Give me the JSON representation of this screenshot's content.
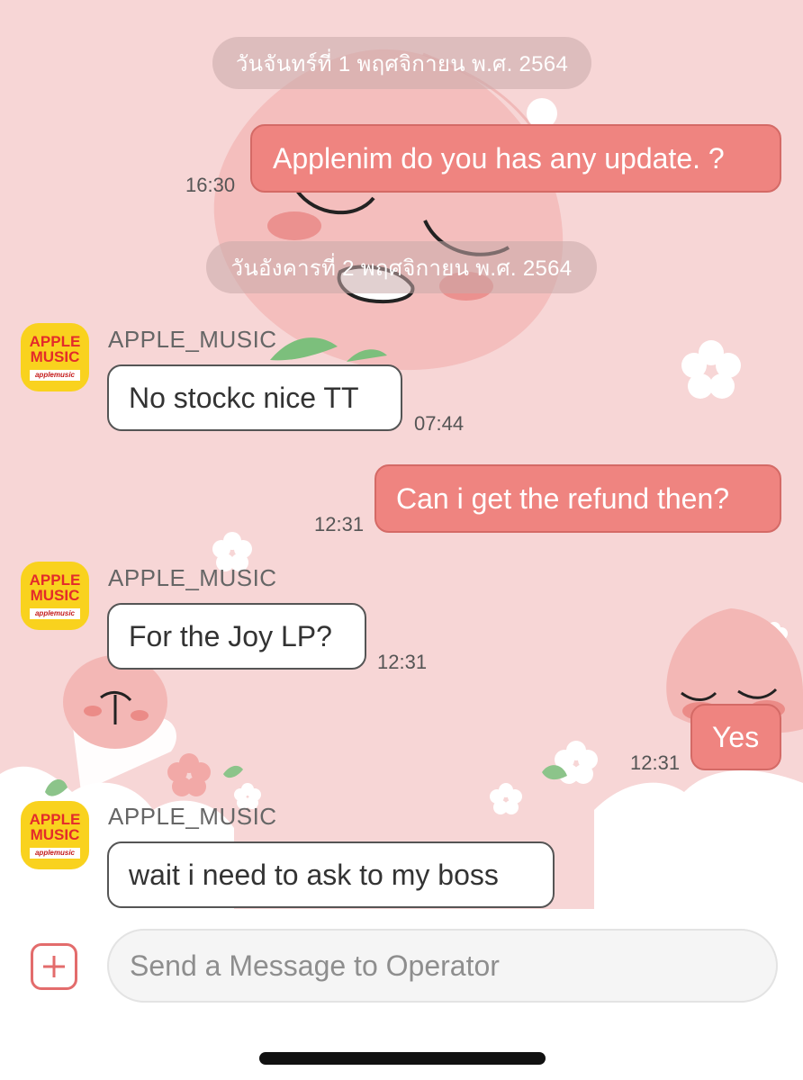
{
  "colors": {
    "background": "#f7d6d6",
    "outgoing_bubble": "#ef8480",
    "incoming_bubble": "#ffffff",
    "plus_accent": "#e36c6c",
    "avatar_bg": "#f9d21e",
    "avatar_text": "#e32b2b"
  },
  "date_separators": [
    "วันจันทร์ที่ 1 พฤศจิกายน พ.ศ. 2564",
    "วันอังคารที่ 2 พฤศจิกายน พ.ศ. 2564"
  ],
  "messages": [
    {
      "direction": "out",
      "text": "Applenim do you has any update. ?",
      "time": "16:30"
    },
    {
      "direction": "in",
      "sender": "APPLE_MUSIC",
      "text": "No stockc nice TT",
      "time": "07:44"
    },
    {
      "direction": "out",
      "text": "Can i get the refund then?",
      "time": "12:31"
    },
    {
      "direction": "in",
      "sender": "APPLE_MUSIC",
      "text": "For the Joy LP?",
      "time": "12:31"
    },
    {
      "direction": "out",
      "text": "Yes",
      "time": "12:31"
    },
    {
      "direction": "in",
      "sender": "APPLE_MUSIC",
      "text": "wait i need to ask to my boss"
    }
  ],
  "avatar": {
    "line1": "APPLE",
    "line2": "MUSIC",
    "sub": "applemusic"
  },
  "composer": {
    "placeholder": "Send a Message to Operator",
    "plus_icon": "plus-icon"
  }
}
